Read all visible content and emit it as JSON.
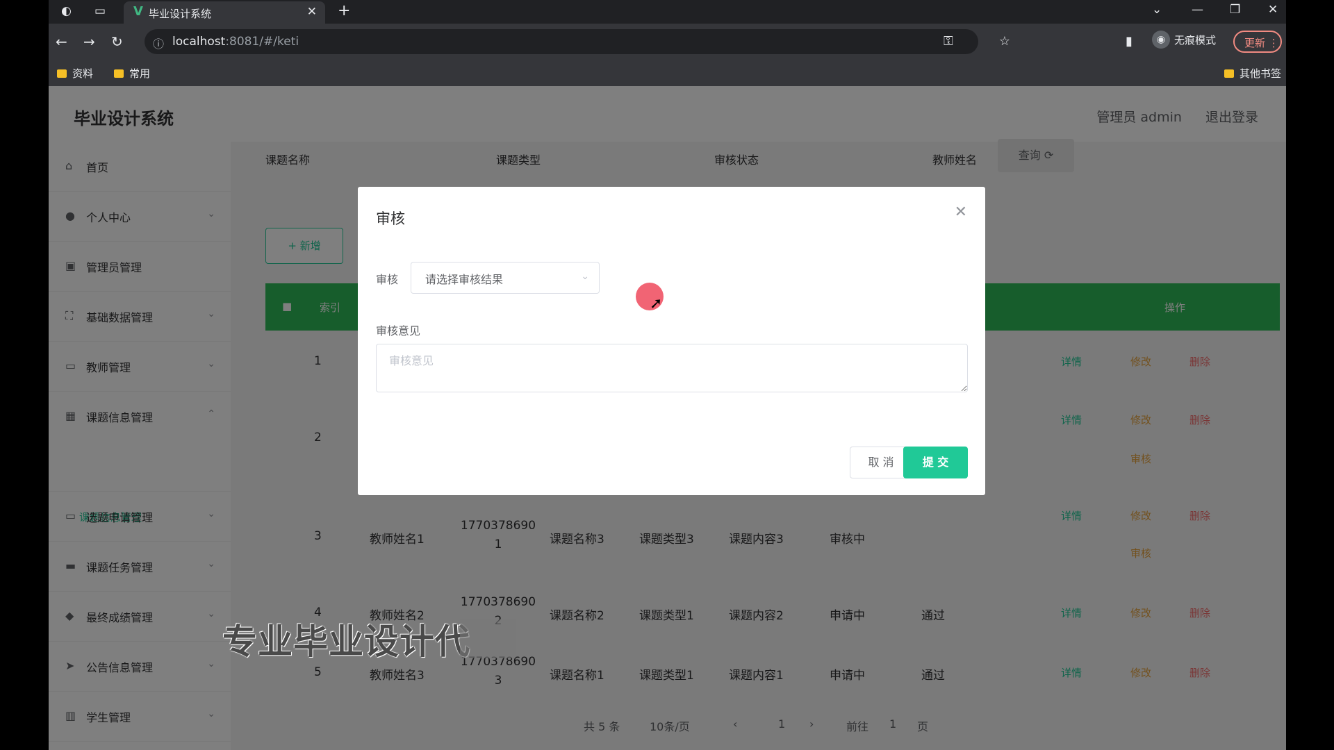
{
  "browser": {
    "tab_title": "毕业设计系统",
    "url_host": "localhost",
    "url_path": ":8081/#/keti",
    "incognito_label": "无痕模式",
    "update_label": "更新",
    "bookmarks": [
      "资料",
      "常用"
    ],
    "other_bookmarks": "其他书签"
  },
  "header": {
    "brand": "毕业设计系统",
    "user": "管理员 admin",
    "logout": "退出登录"
  },
  "sidebar": {
    "items": [
      {
        "label": "首页",
        "icon": "home-icon"
      },
      {
        "label": "个人中心",
        "icon": "user-icon"
      },
      {
        "label": "管理员管理",
        "icon": "admin-icon"
      },
      {
        "label": "基础数据管理",
        "icon": "data-icon"
      },
      {
        "label": "教师管理",
        "icon": "teacher-icon"
      },
      {
        "label": "课题信息管理",
        "icon": "topic-icon"
      },
      {
        "label": "选题申请管理",
        "icon": "apply-icon"
      },
      {
        "label": "课题任务管理",
        "icon": "task-icon"
      },
      {
        "label": "最终成绩管理",
        "icon": "score-icon"
      },
      {
        "label": "公告信息管理",
        "icon": "notice-icon"
      },
      {
        "label": "学生管理",
        "icon": "student-icon"
      }
    ],
    "active_sub": "课题信息管理"
  },
  "filters": {
    "topic_name": "课题名称",
    "topic_type": "课题类型",
    "review_status": "审核状态",
    "teacher_name": "教师姓名",
    "query_button": "查询"
  },
  "toolbar": {
    "add_button": "+ 新增"
  },
  "table": {
    "header_index": "索引",
    "header_action": "操作",
    "actions": {
      "detail": "详情",
      "edit": "修改",
      "delete": "删除",
      "review": "审核"
    },
    "rows": [
      {
        "index": "1",
        "teacher": "",
        "phone": "",
        "name": "",
        "type": "",
        "content": "",
        "status": "",
        "result": ""
      },
      {
        "index": "2",
        "teacher": "",
        "phone": "",
        "name": "",
        "type": "",
        "content": "",
        "status": "",
        "result": ""
      },
      {
        "index": "3",
        "teacher": "教师姓名1",
        "phone": "17703786901",
        "name": "课题名称3",
        "type": "课题类型3",
        "content": "课题内容3",
        "status": "审核中",
        "result": ""
      },
      {
        "index": "4",
        "teacher": "教师姓名2",
        "phone": "17703786902",
        "name": "课题名称2",
        "type": "课题类型1",
        "content": "课题内容2",
        "status": "申请中",
        "result": "通过"
      },
      {
        "index": "5",
        "teacher": "教师姓名3",
        "phone": "17703786903",
        "name": "课题名称1",
        "type": "课题类型1",
        "content": "课题内容1",
        "status": "申请中",
        "result": "通过"
      }
    ]
  },
  "pager": {
    "total": "共 5 条",
    "page_size": "10条/页",
    "current": "1",
    "goto_prefix": "前往",
    "goto_value": "1",
    "goto_suffix": "页"
  },
  "dialog": {
    "title": "审核",
    "review_label": "审核",
    "review_placeholder": "请选择审核结果",
    "opinion_label": "审核意见",
    "opinion_placeholder": "审核意见",
    "cancel": "取 消",
    "submit": "提 交"
  },
  "watermark": "专业毕业设计代"
}
